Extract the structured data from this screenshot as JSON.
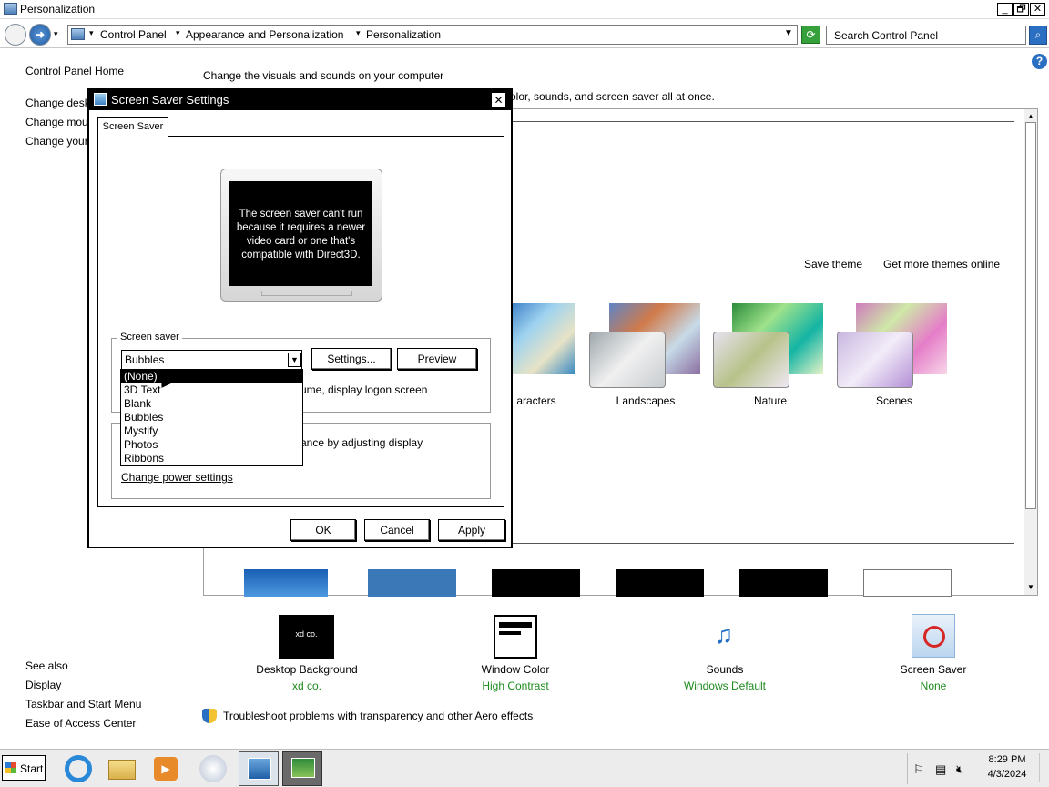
{
  "window": {
    "title": "Personalization",
    "min": "_",
    "max": "🗗",
    "close": "✕"
  },
  "address": {
    "breadcrumb": [
      "Control Panel",
      "Appearance and Personalization",
      "Personalization"
    ],
    "search_placeholder": "Search Control Panel"
  },
  "nav": {
    "home": "Control Panel Home",
    "links": [
      "Change desktop icons",
      "Change mouse pointers",
      "Change your account picture"
    ],
    "see_also": "See also",
    "see_also_links": [
      "Display",
      "Taskbar and Start Menu",
      "Ease of Access Center"
    ]
  },
  "main": {
    "heading": "Change the visuals and sounds on your computer",
    "subheading_tail": "olor, sounds, and screen saver all at once.",
    "save_theme": "Save theme",
    "get_more_themes": "Get more themes online",
    "themes": [
      {
        "label": "aracters"
      },
      {
        "label": "Landscapes"
      },
      {
        "label": "Nature"
      },
      {
        "label": "Scenes"
      }
    ],
    "troubleshoot": "Troubleshoot problems with transparency and other Aero effects"
  },
  "bottom": {
    "items": [
      {
        "label": "Desktop Background",
        "value": "xd co.",
        "thumb_text": "xd co."
      },
      {
        "label": "Window Color",
        "value": "High Contrast"
      },
      {
        "label": "Sounds",
        "value": "Windows Default"
      },
      {
        "label": "Screen Saver",
        "value": "None"
      }
    ]
  },
  "dialog": {
    "title": "Screen Saver Settings",
    "tab": "Screen Saver",
    "preview_message": "The screen saver can't run because it requires a newer video card or one that's compatible with Direct3D.",
    "group_label": "Screen saver",
    "selected": "Bubbles",
    "settings_button": "Settings...",
    "preview_button": "Preview",
    "resume_text": "ume, display logon screen",
    "power_text": "ance by adjusting display",
    "power_link": "Change power settings",
    "options": [
      "(None)",
      "3D Text",
      "Blank",
      "Bubbles",
      "Mystify",
      "Photos",
      "Ribbons"
    ],
    "ok": "OK",
    "cancel": "Cancel",
    "apply": "Apply"
  },
  "taskbar": {
    "start": "Start",
    "time": "8:29 PM",
    "date": "4/3/2024"
  }
}
